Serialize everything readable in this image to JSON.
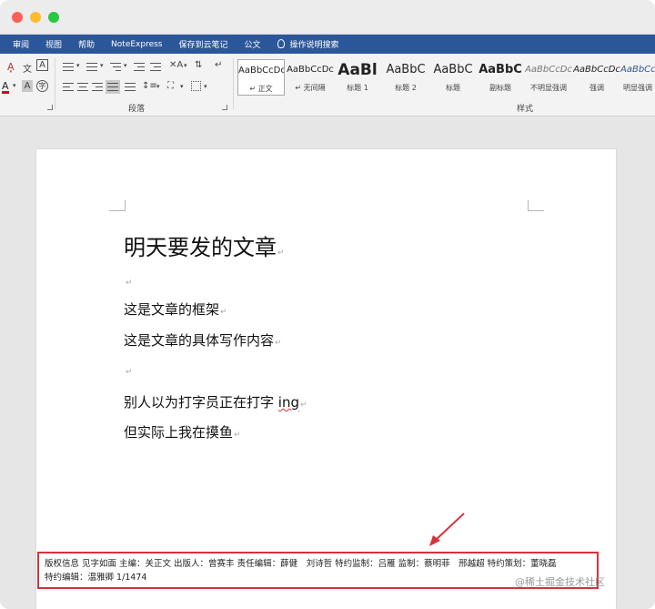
{
  "ribbon_tabs": [
    "审阅",
    "视图",
    "帮助",
    "NoteExpress",
    "保存到云笔记",
    "公文"
  ],
  "tell_me": "操作说明搜索",
  "groups": {
    "paragraph": "段落",
    "styles": "样式"
  },
  "styles": [
    {
      "sample": "AaBbCcDc",
      "name": "↵ 正文"
    },
    {
      "sample": "AaBbCcDc",
      "name": "↵ 无间隔"
    },
    {
      "sample": "AaBl",
      "name": "标题 1"
    },
    {
      "sample": "AaBbC",
      "name": "标题 2"
    },
    {
      "sample": "AaBbC",
      "name": "标题"
    },
    {
      "sample": "AaBbC",
      "name": "副标题"
    },
    {
      "sample": "AaBbCcDc",
      "name": "不明显强调"
    },
    {
      "sample": "AaBbCcDc",
      "name": "强调"
    },
    {
      "sample": "AaBbCcDc",
      "name": "明显强调"
    }
  ],
  "document": {
    "title": "明天要发的文章",
    "line1": "这是文章的框架",
    "line2": "这是文章的具体写作内容",
    "line3_prefix": "别人以为打字员正在打字 ",
    "line3_typo": "ing",
    "line4": "但实际上我在摸鱼",
    "para_mark": "↵"
  },
  "footer_text_line1": "版权信息 见字如面 主编：关正文 出版人：曾赛丰 责任编辑：薛健　刘诗哲 特约监制：吕雁 监制：蔡明菲　邢越超 特约策划：董晓磊",
  "footer_text_line2": "特约编辑：温雅卿 1/1474",
  "watermark": "@稀土掘金技术社区",
  "colors": {
    "accent": "#2b579a",
    "highlight": "#d9303a"
  }
}
